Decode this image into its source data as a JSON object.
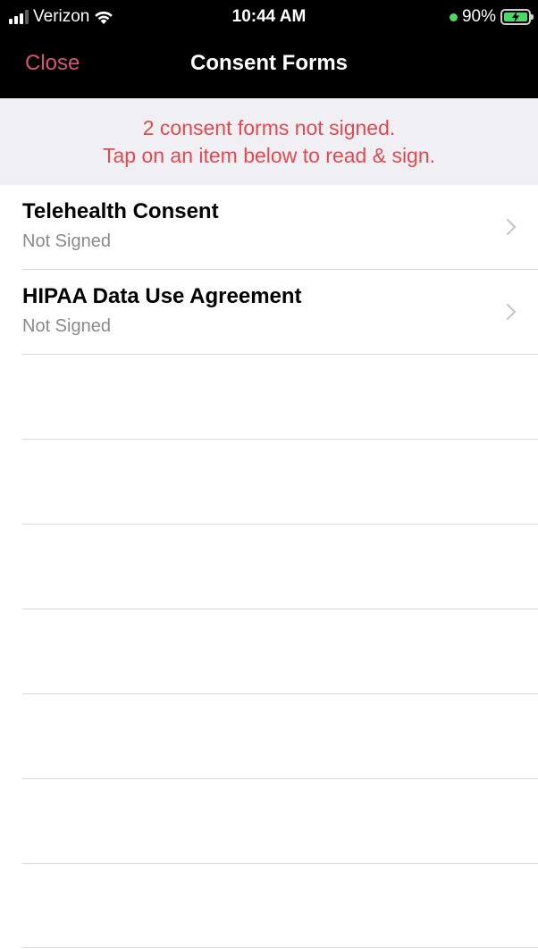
{
  "status_bar": {
    "carrier": "Verizon",
    "time": "10:44 AM",
    "battery": "90%",
    "icons": [
      "signal-icon",
      "wifi-icon",
      "battery-charging-icon"
    ]
  },
  "nav": {
    "close_label": "Close",
    "title": "Consent Forms"
  },
  "banner": {
    "line1": "2 consent forms not signed.",
    "line2": "Tap on an item below to read & sign."
  },
  "forms": [
    {
      "title": "Telehealth Consent",
      "status": "Not Signed"
    },
    {
      "title": "HIPAA Data Use Agreement",
      "status": "Not Signed"
    }
  ],
  "colors": {
    "accent": "#d6537a",
    "warning_text": "#e04a4f",
    "banner_bg": "#efeff4",
    "bar_bg": "#000000"
  }
}
